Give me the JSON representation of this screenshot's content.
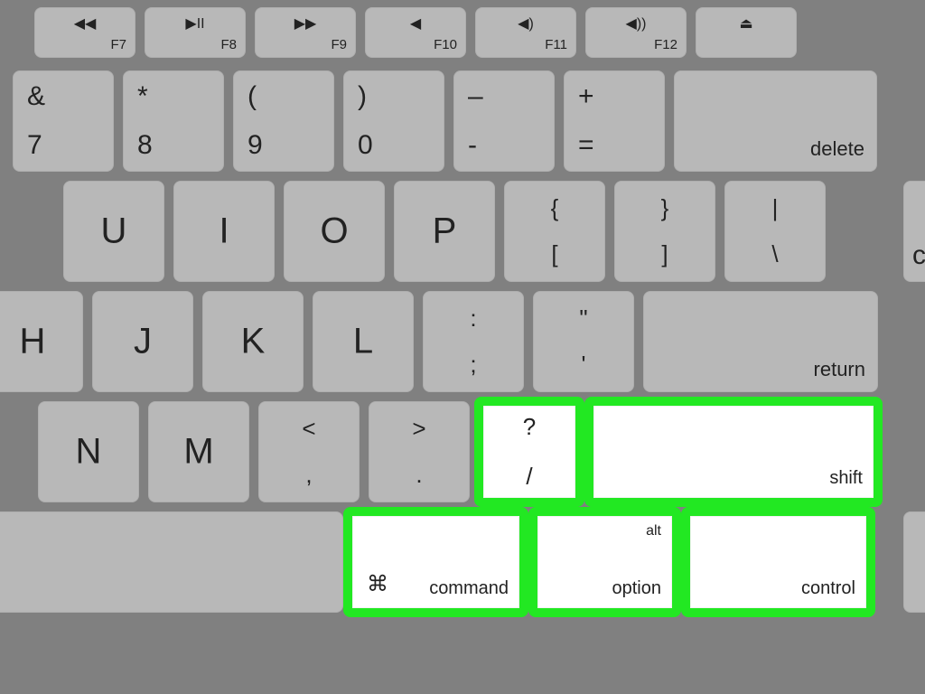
{
  "fn_row": [
    {
      "icon": "◀◀",
      "label": "F7"
    },
    {
      "icon": "▶II",
      "label": "F8"
    },
    {
      "icon": "▶▶",
      "label": "F9"
    },
    {
      "icon": "◀",
      "label": "F10"
    },
    {
      "icon": "◀)",
      "label": "F11"
    },
    {
      "icon": "◀))",
      "label": "F12"
    },
    {
      "icon": "⏏",
      "label": ""
    }
  ],
  "num_row": [
    {
      "top": "&",
      "bot": "7"
    },
    {
      "top": "*",
      "bot": "8"
    },
    {
      "top": "(",
      "bot": "9"
    },
    {
      "top": ")",
      "bot": "0"
    },
    {
      "top": "–",
      "bot": "-"
    },
    {
      "top": "+",
      "bot": "="
    }
  ],
  "delete_label": "delete",
  "letter_row1": [
    {
      "ch": "U"
    },
    {
      "ch": "I"
    },
    {
      "ch": "O"
    },
    {
      "ch": "P"
    }
  ],
  "bracket1": {
    "top": "{",
    "bot": "["
  },
  "bracket2": {
    "top": "}",
    "bot": "]"
  },
  "backslash": {
    "top": "|",
    "bot": "\\"
  },
  "partial_right": "c",
  "letter_row2": [
    {
      "ch": "H"
    },
    {
      "ch": "J"
    },
    {
      "ch": "K"
    },
    {
      "ch": "L"
    }
  ],
  "semicolon": {
    "top": ":",
    "bot": ";"
  },
  "quote": {
    "top": "\"",
    "bot": "'"
  },
  "return_label": "return",
  "letter_row3": [
    {
      "ch": "N"
    },
    {
      "ch": "M"
    }
  ],
  "comma": {
    "top": "<",
    "bot": ","
  },
  "period": {
    "top": ">",
    "bot": "."
  },
  "slash": {
    "top": "?",
    "bot": "/"
  },
  "shift_label": "shift",
  "command_icon": "⌘",
  "command_label": "command",
  "option_alt": "alt",
  "option_label": "option",
  "control_label": "control"
}
